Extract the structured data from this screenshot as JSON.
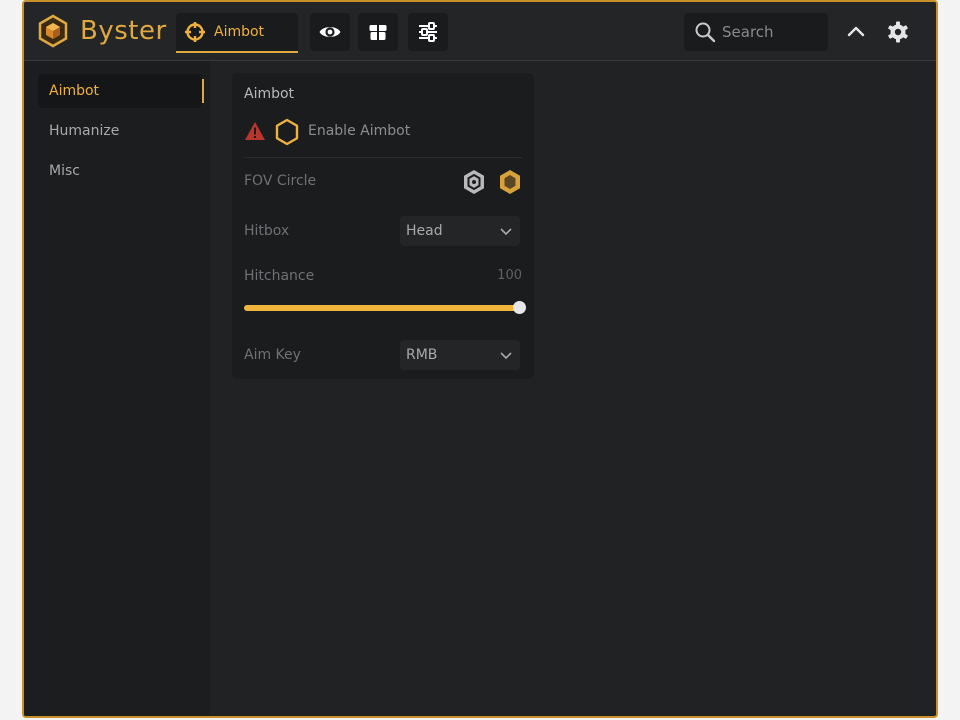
{
  "header": {
    "brand": "Byster",
    "active_tab": {
      "label": "Aimbot",
      "icon": "crosshair-icon"
    },
    "buttons": [
      {
        "icon": "eye-icon"
      },
      {
        "icon": "gift-box-icon"
      },
      {
        "icon": "sliders-icon"
      }
    ],
    "search": {
      "placeholder": "Search",
      "value": ""
    },
    "right_icons": [
      "chevron-up-icon",
      "gear-icon"
    ]
  },
  "sidebar": {
    "items": [
      {
        "label": "Aimbot",
        "active": true
      },
      {
        "label": "Humanize",
        "active": false
      },
      {
        "label": "Misc",
        "active": false
      }
    ]
  },
  "panel": {
    "title": "Aimbot",
    "enable": {
      "label": "Enable Aimbot",
      "warning": true,
      "checked": false
    },
    "fov_circle": {
      "label": "FOV Circle"
    },
    "hitbox": {
      "label": "Hitbox",
      "value": "Head"
    },
    "hitchance": {
      "label": "Hitchance",
      "value": "100",
      "fraction": 1.0
    },
    "aim_key": {
      "label": "Aim Key",
      "value": "RMB"
    }
  },
  "colors": {
    "accent": "#f0b53d",
    "window_border": "#c8902a",
    "background": "#212224",
    "warning": "#c0392b"
  }
}
